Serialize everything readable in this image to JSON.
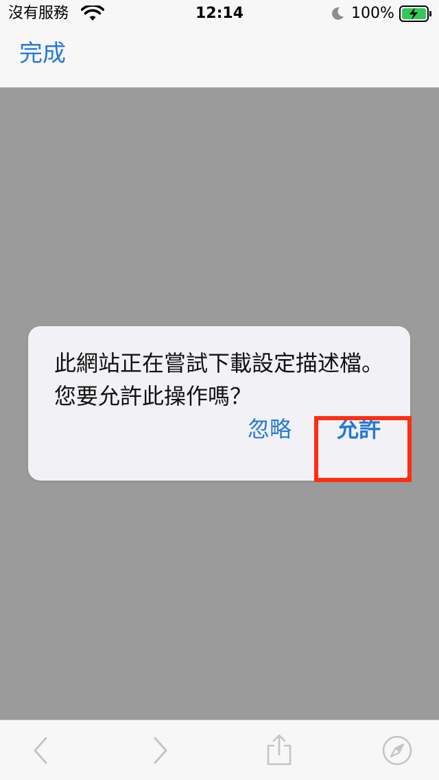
{
  "status_bar": {
    "carrier": "沒有服務",
    "time": "12:14",
    "battery_percent": "100%",
    "icons": [
      "wifi-icon",
      "moon-icon",
      "battery-charging-icon"
    ]
  },
  "nav_bar": {
    "done_label": "完成"
  },
  "alert": {
    "message": "此網站正在嘗試下載設定描述檔。您要允許此操作嗎？",
    "ignore_label": "忽略",
    "allow_label": "允許"
  },
  "toolbar": {
    "icons": [
      "back-icon",
      "forward-icon",
      "share-icon",
      "compass-icon"
    ]
  },
  "colors": {
    "accent": "#2479d8",
    "highlight": "#ff2d12",
    "battery_green": "#34c759",
    "dimmed_background": "#9b9b9b"
  }
}
